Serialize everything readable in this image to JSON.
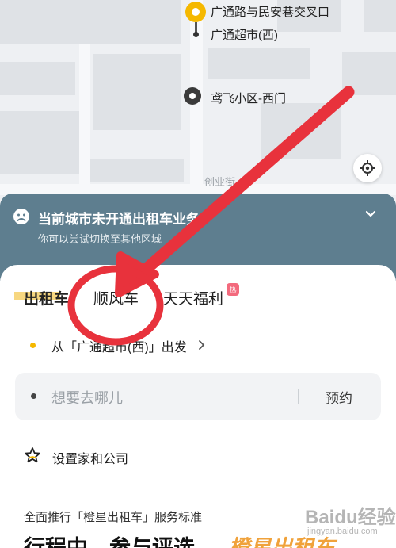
{
  "map": {
    "poi_1": "广通路与民安巷交叉口",
    "poi_2": "广通超市(西)",
    "poi_3": "鸢飞小区-西门",
    "street": "创业街"
  },
  "notice": {
    "title": "当前城市未开通出租车业务",
    "subtitle": "你可以尝试切换至其他区域"
  },
  "tabs": [
    {
      "label": "出租车",
      "active": true
    },
    {
      "label": "顺风车",
      "active": false
    },
    {
      "label": "天天福利",
      "active": false,
      "badge": "热"
    }
  ],
  "pickup": {
    "text": "从「广通超市(西)」出发"
  },
  "destination": {
    "placeholder": "想要去哪儿",
    "reserve_label": "预约"
  },
  "home_company": {
    "label": "设置家和公司"
  },
  "promo": {
    "line": "全面推行「橙星出租车」服务标准",
    "title": "行程中，参与评选",
    "brand": "橙星出租车"
  },
  "watermark": {
    "text": "Baidu经验",
    "sub": "jingyan.baidu.com"
  },
  "colors": {
    "accent_yellow": "#f5b800",
    "notice_bg": "#5e7e8f",
    "annotation_red": "#e8323c",
    "tab_highlight": "#f7d780"
  }
}
